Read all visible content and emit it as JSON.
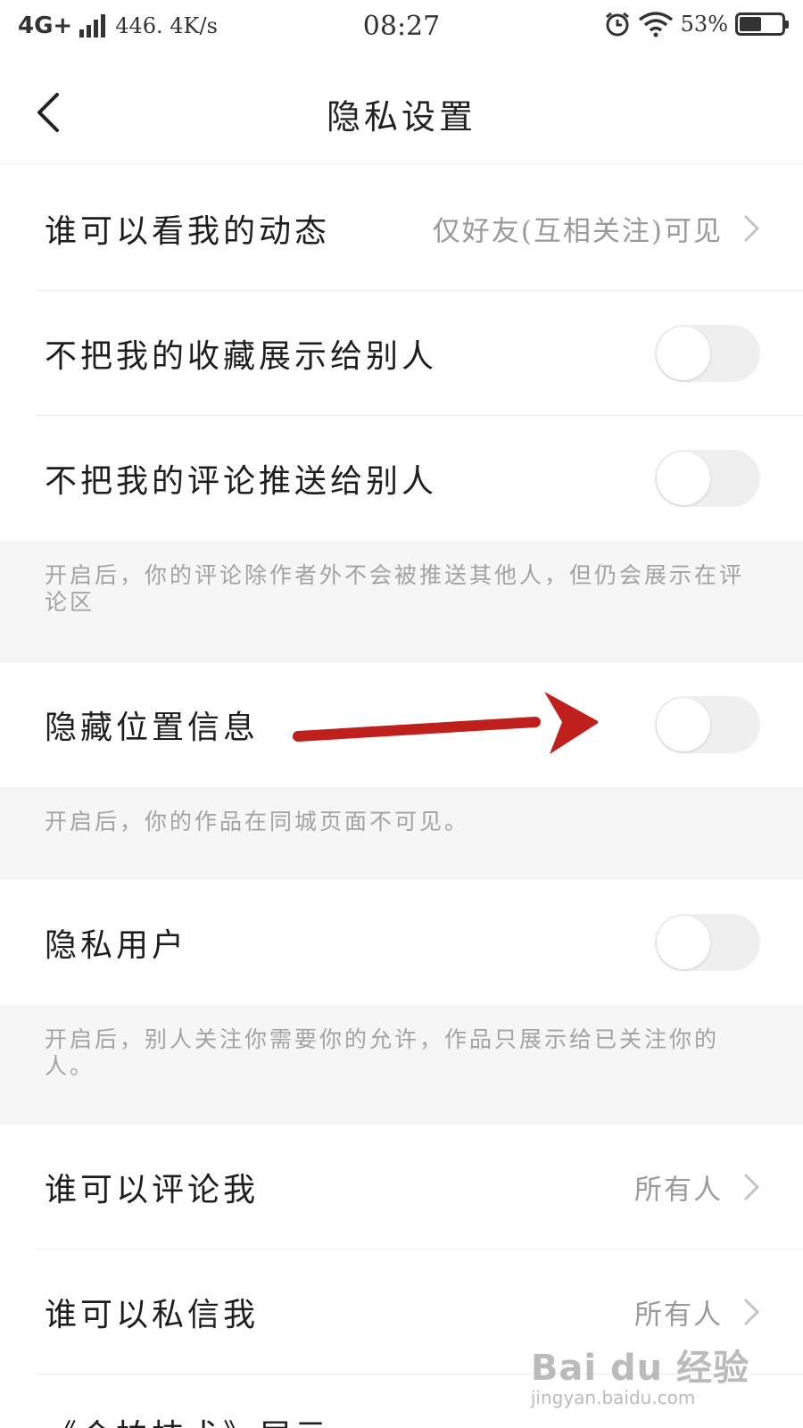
{
  "status_bar": {
    "network": "4G+",
    "speed": "446. 4K/s",
    "time": "08:27",
    "battery_percent": "53%",
    "battery_level": 0.53,
    "icons": [
      "signal-icon",
      "alarm-icon",
      "wifi-icon",
      "battery-icon"
    ]
  },
  "header": {
    "title": "隐私设置",
    "back_icon": "chevron-left-icon"
  },
  "settings": [
    {
      "label": "谁可以看我的动态",
      "value": "仅好友(互相关注)可见",
      "type": "link"
    },
    {
      "label": "不把我的收藏展示给别人",
      "type": "toggle",
      "on": false
    },
    {
      "label": "不把我的评论推送给别人",
      "type": "toggle",
      "on": false
    },
    {
      "label": "隐藏位置信息",
      "type": "toggle",
      "on": false
    },
    {
      "label": "隐私用户",
      "type": "toggle",
      "on": false
    },
    {
      "label": "谁可以评论我",
      "value": "所有人",
      "type": "link"
    },
    {
      "label": "谁可以私信我",
      "value": "所有人",
      "type": "link"
    }
  ],
  "notes": {
    "comments": "开启后，你的评论除作者外不会被推送其他人，但仍会展示在评论区",
    "location": "开启后，你的作品在同城页面不可见。",
    "private_user": "开启后，别人关注你需要你的允许，作品只展示给已关注你的人。"
  },
  "partial_row": "《合拍技术》展示",
  "annotation": {
    "arrow_color": "#c0201c"
  },
  "watermark": {
    "logo": "Bai du 经验",
    "url": "jingyan.baidu.com"
  },
  "colors": {
    "toggle_off": "#efefef",
    "note_bg": "#f6f6f6",
    "secondary_text": "#9a9a9a"
  }
}
